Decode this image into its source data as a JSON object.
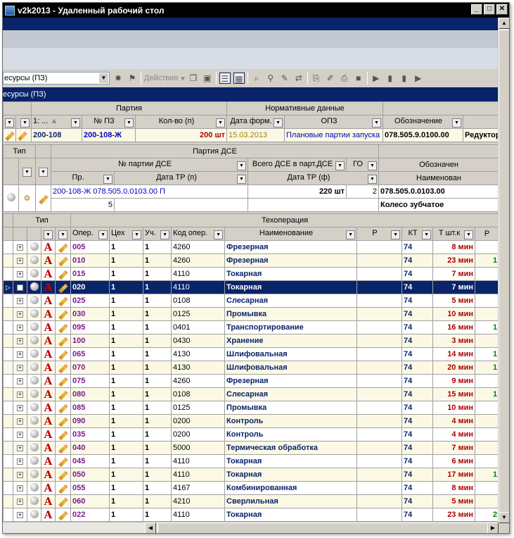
{
  "window": {
    "title": "v2k2013 - Удаленный рабочий стол",
    "minimize": "_",
    "maximize": "□",
    "close": "✕"
  },
  "toolbar": {
    "combo_value": "есурсы (ПЗ)",
    "actions_label": "Действия"
  },
  "panel_tab": "есурсы (ПЗ)",
  "grid1": {
    "group_headers": [
      "Партия",
      "Нормативные данные"
    ],
    "columns": [
      "1: ...",
      "№ ПЗ",
      "Кол-во (п)",
      "Дата форм.",
      "ОПЗ",
      "Обозначение"
    ],
    "row": {
      "code": "200-108",
      "pz": "200-108-Ж",
      "qty": "200 шт",
      "date": "15.03.2013",
      "opz": "Плановые партии запуска",
      "designation": "078.505.9.0100.00",
      "name": "Редуктор"
    }
  },
  "grid2": {
    "type_header": "Тип",
    "group_header": "Партия ДСЕ",
    "columns": [
      "№ партии ДСЕ",
      "Всего ДСЕ в парт.ДСЕ",
      "ГО",
      "Обозначен",
      "Пр.",
      "Дата ТР (п)",
      "Дата ТР (ф)",
      "Наименован"
    ],
    "row": {
      "batch": "200-108-Ж 078.505.0.0103.00 П",
      "total": "220 шт",
      "go": "2",
      "designation": "078.505.0.0103.00",
      "pr": "5",
      "name": "Колесо зубчатое"
    }
  },
  "ops": {
    "type_header": "Тип",
    "group_header": "Техоперация",
    "columns": [
      "Опер.",
      "Цех",
      "Уч.",
      "Код опер.",
      "Наименование",
      "Р",
      "КТ",
      "Т шт.к",
      "Р"
    ],
    "rows": [
      {
        "op": "005",
        "shop": "1",
        "sec": "1",
        "code": "4260",
        "name": "Фрезерная",
        "kt": "74",
        "time": "8 мин",
        "extra": ""
      },
      {
        "op": "010",
        "shop": "1",
        "sec": "1",
        "code": "4260",
        "name": "Фрезерная",
        "kt": "74",
        "time": "23 мин",
        "extra": "1"
      },
      {
        "op": "015",
        "shop": "1",
        "sec": "1",
        "code": "4110",
        "name": "Токарная",
        "kt": "74",
        "time": "7 мин",
        "extra": ""
      },
      {
        "op": "020",
        "shop": "1",
        "sec": "1",
        "code": "4110",
        "name": "Токарная",
        "kt": "74",
        "time": "7 мин",
        "extra": ""
      },
      {
        "op": "025",
        "shop": "1",
        "sec": "1",
        "code": "0108",
        "name": "Слесарная",
        "kt": "74",
        "time": "5 мин",
        "extra": ""
      },
      {
        "op": "030",
        "shop": "1",
        "sec": "1",
        "code": "0125",
        "name": "Промывка",
        "kt": "74",
        "time": "10 мин",
        "extra": ""
      },
      {
        "op": "095",
        "shop": "1",
        "sec": "1",
        "code": "0401",
        "name": "Транспортирование",
        "kt": "74",
        "time": "16 мин",
        "extra": "1"
      },
      {
        "op": "100",
        "shop": "1",
        "sec": "1",
        "code": "0430",
        "name": "Хранение",
        "kt": "74",
        "time": "3 мин",
        "extra": ""
      },
      {
        "op": "065",
        "shop": "1",
        "sec": "1",
        "code": "4130",
        "name": "Шлифовальная",
        "kt": "74",
        "time": "14 мин",
        "extra": "1"
      },
      {
        "op": "070",
        "shop": "1",
        "sec": "1",
        "code": "4130",
        "name": "Шлифовальная",
        "kt": "74",
        "time": "20 мин",
        "extra": "1"
      },
      {
        "op": "075",
        "shop": "1",
        "sec": "1",
        "code": "4260",
        "name": "Фрезерная",
        "kt": "74",
        "time": "9 мин",
        "extra": ""
      },
      {
        "op": "080",
        "shop": "1",
        "sec": "1",
        "code": "0108",
        "name": "Слесарная",
        "kt": "74",
        "time": "15 мин",
        "extra": "1"
      },
      {
        "op": "085",
        "shop": "1",
        "sec": "1",
        "code": "0125",
        "name": "Промывка",
        "kt": "74",
        "time": "10 мин",
        "extra": ""
      },
      {
        "op": "090",
        "shop": "1",
        "sec": "1",
        "code": "0200",
        "name": "Контроль",
        "kt": "74",
        "time": "4 мин",
        "extra": ""
      },
      {
        "op": "035",
        "shop": "1",
        "sec": "1",
        "code": "0200",
        "name": "Контроль",
        "kt": "74",
        "time": "4 мин",
        "extra": ""
      },
      {
        "op": "040",
        "shop": "1",
        "sec": "1",
        "code": "5000",
        "name": "Термическая обработка",
        "kt": "74",
        "time": "7 мин",
        "extra": ""
      },
      {
        "op": "045",
        "shop": "1",
        "sec": "1",
        "code": "4110",
        "name": "Токарная",
        "kt": "74",
        "time": "6 мин",
        "extra": ""
      },
      {
        "op": "050",
        "shop": "1",
        "sec": "1",
        "code": "4110",
        "name": "Токарная",
        "kt": "74",
        "time": "17 мин",
        "extra": "1"
      },
      {
        "op": "055",
        "shop": "1",
        "sec": "1",
        "code": "4167",
        "name": "Комбинированная",
        "kt": "74",
        "time": "8 мин",
        "extra": ""
      },
      {
        "op": "060",
        "shop": "1",
        "sec": "1",
        "code": "4210",
        "name": "Сверлильная",
        "kt": "74",
        "time": "5 мин",
        "extra": ""
      },
      {
        "op": "022",
        "shop": "1",
        "sec": "1",
        "code": "4110",
        "name": "Токарная",
        "kt": "74",
        "time": "23 мин",
        "extra": "2"
      }
    ],
    "selected_index": 3
  }
}
